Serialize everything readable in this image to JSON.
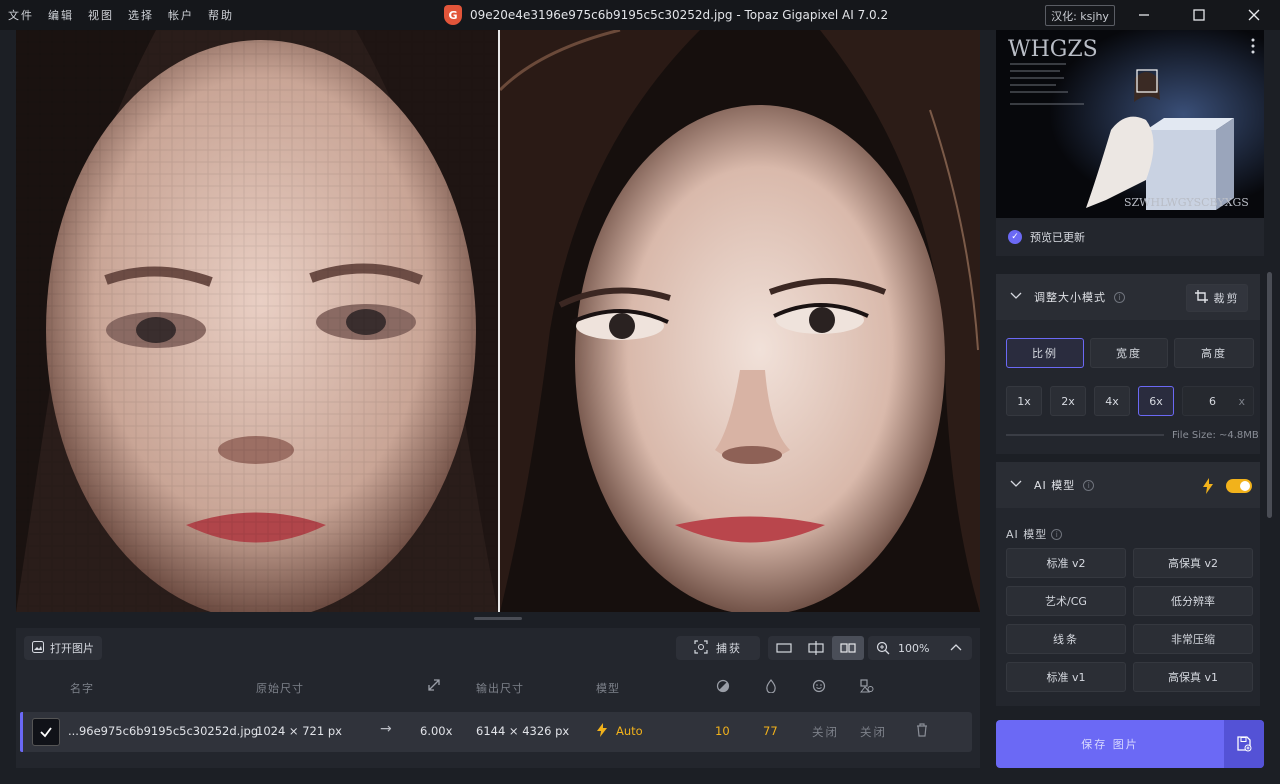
{
  "menu": [
    "文件",
    "编辑",
    "视图",
    "选择",
    "帐户",
    "帮助"
  ],
  "window": {
    "logo_letter": "G",
    "title": "09e20e4e3196e975c6b9195c5c30252d.jpg - Topaz Gigapixel AI 7.0.2",
    "hanhua": "汉化: ksjhy"
  },
  "thumbnail": {
    "brand_text": "WHGZS",
    "bottom_text": "SZWHLWGYSCBYXGS"
  },
  "preview_status": "预览已更新",
  "resize": {
    "title": "调整大小模式",
    "crop_label": "裁剪",
    "mode_tabs": [
      "比例",
      "宽度",
      "高度"
    ],
    "selected_mode": "比例",
    "scales": [
      "1x",
      "2x",
      "4x",
      "6x"
    ],
    "selected_scale": "6x",
    "custom_value": "6",
    "custom_unit": "x",
    "file_size": "File Size: ~4.8MB"
  },
  "ai_model": {
    "title": "AI 模型",
    "subtitle": "AI 模型",
    "toggle_on": true,
    "models": [
      "标准 v2",
      "高保真 v2",
      "艺术/CG",
      "低分辨率",
      "线条",
      "非常压缩",
      "标准 v1",
      "高保真 v1"
    ]
  },
  "save": {
    "label": "保存 图片"
  },
  "toolbar": {
    "open_label": "打开图片",
    "capture_label": "捕获",
    "zoom": "100%"
  },
  "table": {
    "headers": {
      "name": "名字",
      "original": "原始尺寸",
      "output": "输出尺寸",
      "model": "模型"
    },
    "row": {
      "name": "...96e975c6b9195c5c30252d.jpg",
      "original": "1024 × 721 px",
      "arrow": "→",
      "scale": "6.00x",
      "output": "6144 × 4326 px",
      "model": "Auto",
      "v1": "10",
      "v2": "77",
      "off1": "关闭",
      "off2": "关闭"
    }
  },
  "colors": {
    "accent": "#6b69f5",
    "yellow": "#f2b21b"
  }
}
